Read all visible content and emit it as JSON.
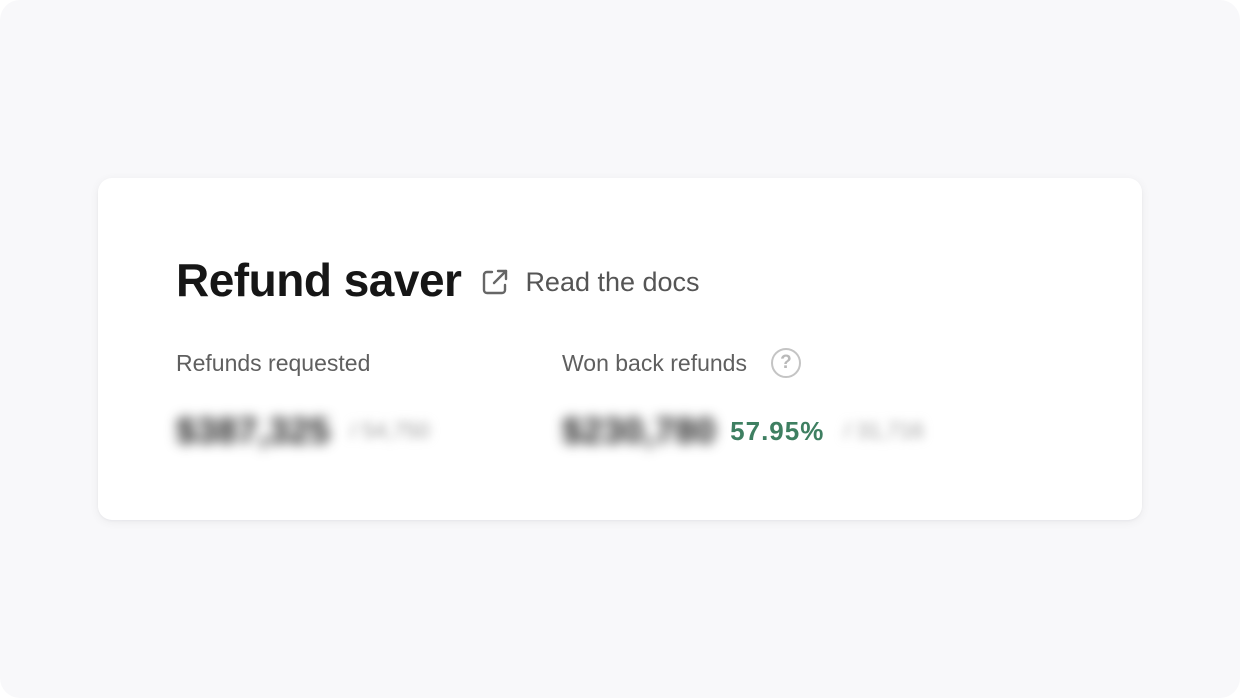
{
  "card": {
    "title": "Refund saver",
    "docs_link": {
      "label": "Read the docs",
      "icon": "external-link-icon"
    }
  },
  "stats": {
    "refunds_requested": {
      "label": "Refunds requested",
      "amount": "$387,325",
      "sub_value": "/ 54,750"
    },
    "won_back": {
      "label": "Won back refunds",
      "help_icon": "question-icon",
      "amount": "$230,780",
      "percent": "57.95%",
      "sub_value": "/ 31,716"
    }
  },
  "colors": {
    "accent_green": "#3e7f61",
    "background": "#f8f8fa"
  }
}
